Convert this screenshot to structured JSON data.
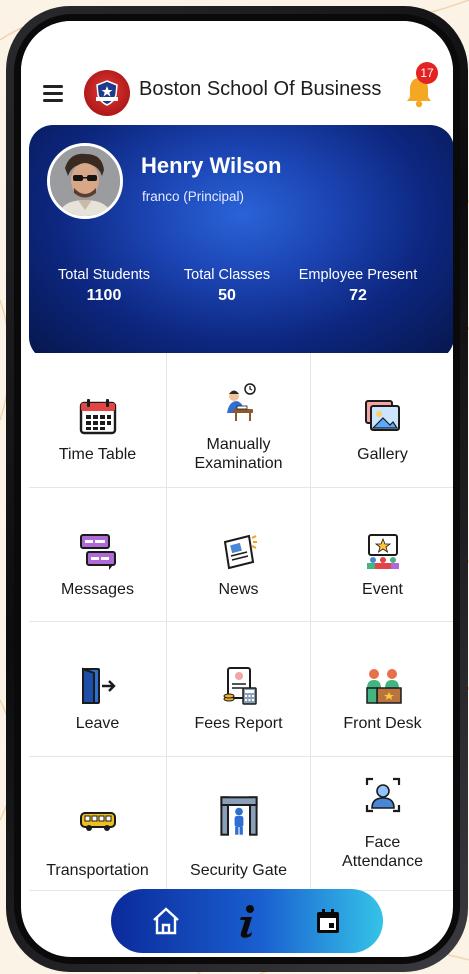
{
  "header": {
    "title": "Boston School Of Business",
    "notification_count": "17"
  },
  "profile": {
    "name": "Henry Wilson",
    "role": "franco (Principal)"
  },
  "stats": [
    {
      "label": "Total Students",
      "value": "1100"
    },
    {
      "label": "Total Classes",
      "value": "50"
    },
    {
      "label": "Employee Present",
      "value": "72"
    }
  ],
  "menu": [
    {
      "label": "Time Table",
      "icon": "calendar-icon"
    },
    {
      "label": "Manually Examination",
      "icon": "exam-icon"
    },
    {
      "label": "Gallery",
      "icon": "gallery-icon"
    },
    {
      "label": "Messages",
      "icon": "messages-icon"
    },
    {
      "label": "News",
      "icon": "news-icon"
    },
    {
      "label": "Event",
      "icon": "event-icon"
    },
    {
      "label": "Leave",
      "icon": "leave-door-icon"
    },
    {
      "label": "Fees Report",
      "icon": "fees-report-icon"
    },
    {
      "label": "Front Desk",
      "icon": "front-desk-icon"
    },
    {
      "label": "Transportation",
      "icon": "bus-icon"
    },
    {
      "label": "Security Gate",
      "icon": "security-gate-icon"
    },
    {
      "label": "Face Attendance",
      "icon": "face-scan-icon"
    }
  ],
  "bottom_nav": [
    {
      "icon": "home-icon"
    },
    {
      "icon": "info-icon"
    },
    {
      "icon": "calendar-event-icon"
    }
  ],
  "colors": {
    "card_blue": "#0d2780",
    "badge_red": "#e52222",
    "bell_orange": "#f5a623",
    "nav_gradient_start": "#0b2a9b",
    "nav_gradient_end": "#35c3e8"
  }
}
